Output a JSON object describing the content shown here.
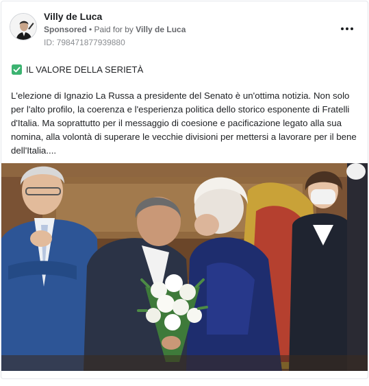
{
  "post": {
    "page_name": "Villy de Luca",
    "sponsored_label": "Sponsored",
    "separator": " • ",
    "paid_for_prefix": "Paid for by ",
    "paid_for_by": "Villy de Luca",
    "ad_id": "ID: 798471877939880",
    "more_icon": "more-horizontal-icon",
    "headline_icon": "check-box-icon",
    "headline_icon_color": "#3cb371",
    "headline": "IL VALORE DELLA SERIETÀ",
    "body": "L'elezione di Ignazio La Russa a presidente del Senato è un'ottima notizia. Non solo per l'alto profilo, la coerenza e l'esperienza politica dello storico esponente di Fratelli d'Italia. Ma soprattutto per il messaggio di coesione e pacificazione legato alla sua nomina, alla volontà di superare le vecchie divisioni per mettersi a lavorare per il bene dell'Italia...."
  }
}
